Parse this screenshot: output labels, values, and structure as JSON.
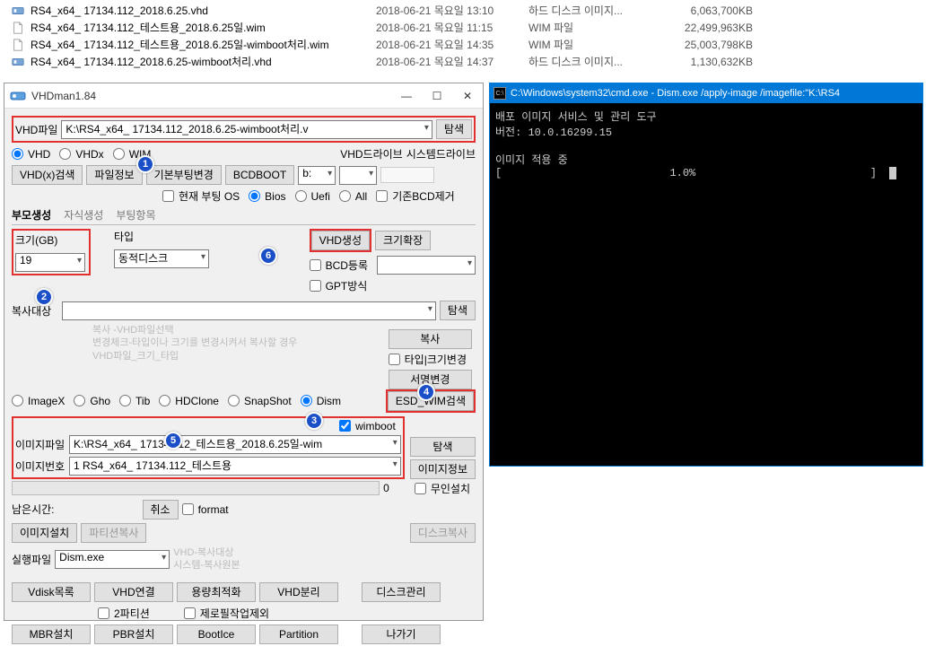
{
  "file_list": [
    {
      "icon": "vhd",
      "name": "RS4_x64_ 17134.112_2018.6.25.vhd",
      "date": "2018-06-21 목요일 13:10",
      "type": "하드 디스크 이미지...",
      "size": "6,063,700KB"
    },
    {
      "icon": "wim",
      "name": "RS4_x64_ 17134.112_테스트용_2018.6.25일.wim",
      "date": "2018-06-21 목요일 11:15",
      "type": "WIM 파일",
      "size": "22,499,963KB"
    },
    {
      "icon": "wim",
      "name": "RS4_x64_ 17134.112_테스트용_2018.6.25일-wimboot처리.wim",
      "date": "2018-06-21 목요일 14:35",
      "type": "WIM 파일",
      "size": "25,003,798KB"
    },
    {
      "icon": "vhd",
      "name": "RS4_x64_ 17134.112_2018.6.25-wimboot처리.vhd",
      "date": "2018-06-21 목요일 14:37",
      "type": "하드 디스크 이미지...",
      "size": "1,130,632KB"
    }
  ],
  "vhdman": {
    "title": "VHDman1.84",
    "labels": {
      "vhd_file": "VHD파일",
      "browse": "탐색",
      "vhd": "VHD",
      "vhdx": "VHDx",
      "wim": "WIM",
      "vhd_drive": "VHD드라이브",
      "system_drive": "시스템드라이브",
      "vhd_search": "VHD(x)검색",
      "file_info": "파일정보",
      "base_boot_change": "기본부팅변경",
      "bcdboot": "BCDBOOT",
      "current_boot_os": "현재 부팅 OS",
      "bios": "Bios",
      "uefi": "Uefi",
      "all": "All",
      "remove_existing_bcd": "기존BCD제거",
      "parent_gen": "부모생성",
      "child_gen": "자식생성",
      "boot_entry": "부팅항목",
      "size_gb": "크기(GB)",
      "type": "타입",
      "vhd_create": "VHD생성",
      "expand_size": "크기확장",
      "dynamic_disk": "동적디스크",
      "bcd_register": "BCD등록",
      "gpt_mode": "GPT방식",
      "copy_target": "복사대상",
      "copy": "복사",
      "type_size_change": "타입|크기변경",
      "sig_change": "서명변경",
      "esd_wim_search": "ESD_WIM검색",
      "imagex": "ImageX",
      "gho": "Gho",
      "tib": "Tib",
      "hdclone": "HDClone",
      "snapshot": "SnapShot",
      "dism": "Dism",
      "wimboot": "wimboot",
      "image_file": "이미지파일",
      "image_number": "이미지번호",
      "image_info": "이미지정보",
      "unattended": "무인설치",
      "time_left": "남은시간:",
      "cancel": "취소",
      "format": "format",
      "image_install": "이미지설치",
      "partition_copy": "파티션복사",
      "disk_copy": "디스크복사",
      "run_file": "실행파일",
      "vhd_copytarget": "VHD-복사대상",
      "system_copysource": "시스템-복사원본",
      "vdisk_list": "Vdisk목록",
      "vhd_connect": "VHD연결",
      "optimize_capacity": "용량최적화",
      "vhd_split": "VHD분리",
      "disk_manage": "디스크관리",
      "two_partition": "2파티션",
      "exclude_zerofill": "제로필작업제외",
      "mbr_install": "MBR설치",
      "pbr_install": "PBR설치",
      "bootice": "BootIce",
      "partition": "Partition",
      "exit": "나가기",
      "progress_zero": "0"
    },
    "values": {
      "vhd_file_path": "K:\\RS4_x64_ 17134.112_2018.6.25-wimboot처리.v",
      "drive_b": "b:",
      "size_gb": "19",
      "image_file": "K:\\RS4_x64_ 17134.112_테스트용_2018.6.25일-wim",
      "image_number": "1 RS4_x64_ 17134.112_테스트용",
      "run_file": "Dism.exe"
    },
    "hints": {
      "copy_hint1": "복사     -VHD파일선택",
      "copy_hint2": "변경체크-타입이나 크기를 변경시켜서 복사할 경우",
      "copy_hint3": "             VHD파일_크기_타입"
    }
  },
  "cmd": {
    "title": "C:\\Windows\\system32\\cmd.exe - Dism.exe  /apply-image /imagefile:\"K:\\RS4",
    "line1": "배포 이미지 서비스 및 관리 도구",
    "line2": "버전: 10.0.16299.15",
    "line3": "이미지 적용 중",
    "progress_left": "[",
    "progress_pct": "1.0%",
    "progress_right": "]"
  }
}
